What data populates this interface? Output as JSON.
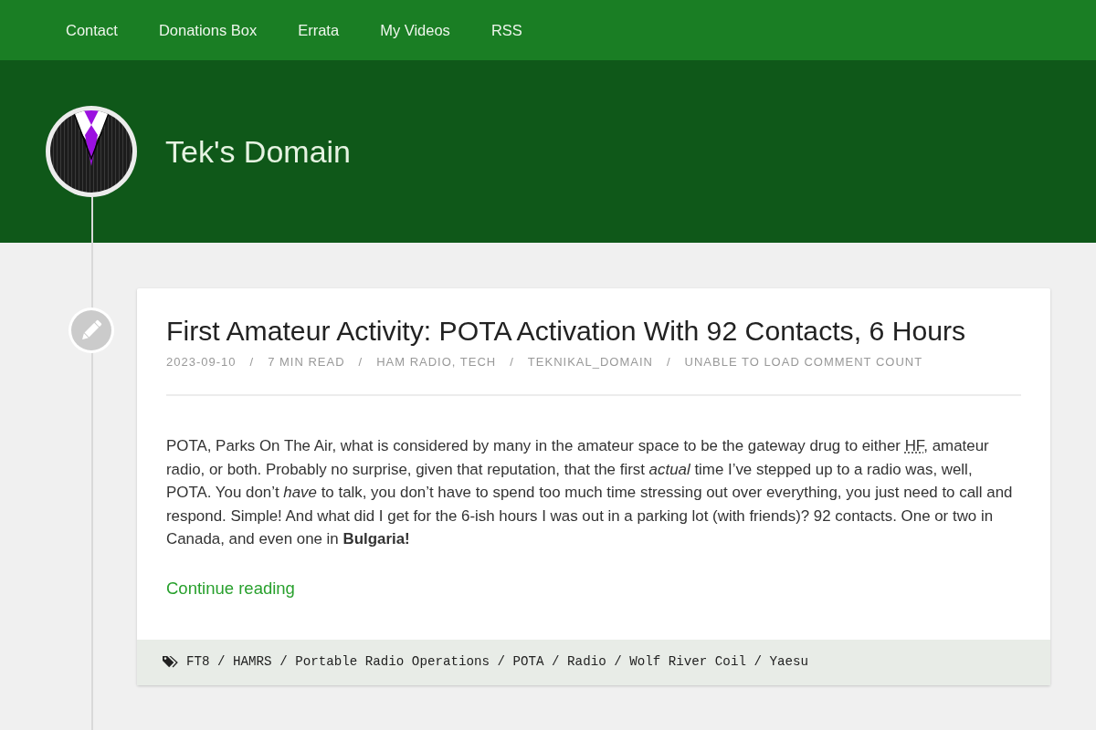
{
  "nav": {
    "links": [
      "Contact",
      "Donations Box",
      "Errata",
      "My Videos",
      "RSS"
    ]
  },
  "header": {
    "site_title": "Tek's Domain"
  },
  "post": {
    "title": "First Amateur Activity: POTA Activation With 92 Contacts, 6 Hours",
    "meta": [
      {
        "kind": "text",
        "text": "2023-09-10"
      },
      {
        "kind": "separator",
        "text": "/"
      },
      {
        "kind": "text",
        "text": "7 MIN READ"
      },
      {
        "kind": "separator",
        "text": "/"
      },
      {
        "kind": "link",
        "text": "HAM RADIO, TECH"
      },
      {
        "kind": "separator",
        "text": "/"
      },
      {
        "kind": "link",
        "text": "TEKNIKAL_DOMAIN"
      },
      {
        "kind": "separator",
        "text": "/"
      },
      {
        "kind": "text",
        "text": "UNABLE TO LOAD COMMENT COUNT"
      }
    ],
    "excerpt": [
      {
        "kind": "text",
        "text": "POTA, Parks On The Air, what is considered by many in the amateur space to be the gateway drug to either "
      },
      {
        "kind": "abbr",
        "text": "HF"
      },
      {
        "kind": "text",
        "text": ", amateur radio, or both. Probably no surprise, given that reputation, that the first *actual* time I’ve stepped up to a radio was, well, POTA. You don’t *have* to talk, you don’t have to spend too much time stressing out over everything, you just need to call and respond. Simple! And what did I get for the 6-ish hours I was out in a parking lot (with friends)? 92 contacts. One or two in Canada, and even one in **Bulgaria!**"
      }
    ],
    "continue_link": "Continue reading",
    "tags": [
      {
        "kind": "tag",
        "text": "FT8"
      },
      {
        "kind": "separator",
        "text": "/"
      },
      {
        "kind": "tag",
        "text": "HAMRS"
      },
      {
        "kind": "separator",
        "text": "/"
      },
      {
        "kind": "tag",
        "text": "Portable Radio Operations"
      },
      {
        "kind": "separator",
        "text": "/"
      },
      {
        "kind": "tag",
        "text": "POTA"
      },
      {
        "kind": "separator",
        "text": "/"
      },
      {
        "kind": "tag",
        "text": "Radio"
      },
      {
        "kind": "separator",
        "text": "/"
      },
      {
        "kind": "tag",
        "text": "Wolf River Coil"
      },
      {
        "kind": "separator",
        "text": "/"
      },
      {
        "kind": "tag",
        "text": "Yaesu"
      }
    ]
  }
}
